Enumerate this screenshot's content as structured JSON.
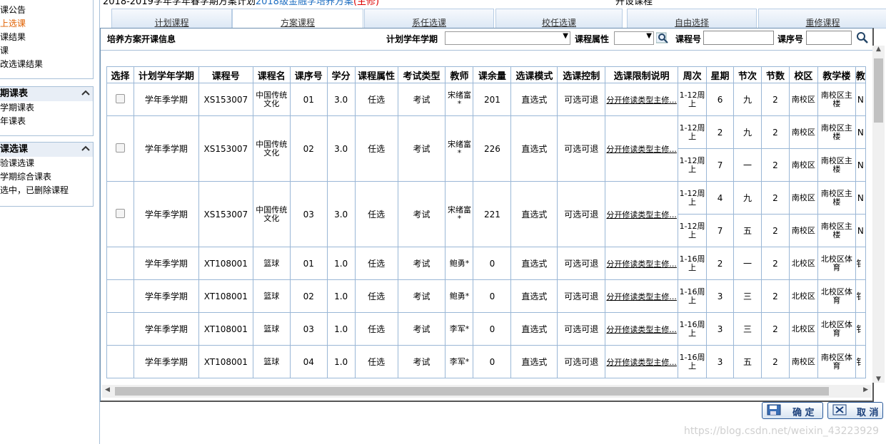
{
  "sidebar": {
    "top_items": [
      "课公告",
      "上选课",
      "课结果",
      "课",
      "改选课结果"
    ],
    "section1": {
      "title": "期课表",
      "items": [
        "学期课表",
        "年课表"
      ]
    },
    "section2": {
      "title": "课选课",
      "items": [
        "验课选课",
        "学期综合课表",
        "选中，已删除课程"
      ]
    }
  },
  "header": {
    "title_prefix": "2018-2019学年学年春学期方案计划",
    "title_blue": "2018级金融学培养方案",
    "title_red": "(主修)",
    "right_text": "开设课程"
  },
  "tabs": [
    "计划课程",
    "方案课程",
    "系任选课",
    "校任选课",
    "自由选择",
    "重修课程"
  ],
  "filter": {
    "title": "培养方案开课信息",
    "term_label": "计划学年学期",
    "attr_label": "课程属性",
    "course_no_label": "课程号",
    "seq_no_label": "课序号"
  },
  "columns": [
    "选择",
    "计划学年学期",
    "课程号",
    "课程名",
    "课序号",
    "学分",
    "课程属性",
    "考试类型",
    "教师",
    "课余量",
    "选课模式",
    "选课控制",
    "选课限制说明",
    "周次",
    "星期",
    "节次",
    "节数",
    "校区",
    "教学楼",
    "教"
  ],
  "rows": [
    {
      "check": true,
      "term": "学年季学期",
      "cno": "XS153007",
      "cname": "中国传统文化",
      "seq": "01",
      "credit": "3.0",
      "attr": "任选",
      "exam": "考试",
      "teacher": "宋绪富*",
      "remain": "201",
      "mode": "直选式",
      "ctrl": "可选可退",
      "limit": "分开修读类型主修...",
      "sessions": [
        {
          "weeks": "1-12周上",
          "day": "6",
          "period": "九",
          "count": "2",
          "campus": "南校区",
          "bldg": "南校区主楼",
          "extra": "N"
        }
      ]
    },
    {
      "check": true,
      "term": "学年季学期",
      "cno": "XS153007",
      "cname": "中国传统文化",
      "seq": "02",
      "credit": "3.0",
      "attr": "任选",
      "exam": "考试",
      "teacher": "宋绪富*",
      "remain": "226",
      "mode": "直选式",
      "ctrl": "可选可退",
      "limit": "分开修读类型主修...",
      "sessions": [
        {
          "weeks": "1-12周上",
          "day": "2",
          "period": "九",
          "count": "2",
          "campus": "南校区",
          "bldg": "南校区主楼",
          "extra": "N"
        },
        {
          "weeks": "1-12周上",
          "day": "7",
          "period": "一",
          "count": "2",
          "campus": "南校区",
          "bldg": "南校区主楼",
          "extra": "N"
        }
      ]
    },
    {
      "check": true,
      "term": "学年季学期",
      "cno": "XS153007",
      "cname": "中国传统文化",
      "seq": "03",
      "credit": "3.0",
      "attr": "任选",
      "exam": "考试",
      "teacher": "宋绪富*",
      "remain": "221",
      "mode": "直选式",
      "ctrl": "可选可退",
      "limit": "分开修读类型主修...",
      "sessions": [
        {
          "weeks": "1-12周上",
          "day": "4",
          "period": "九",
          "count": "2",
          "campus": "南校区",
          "bldg": "南校区主楼",
          "extra": "N"
        },
        {
          "weeks": "1-12周上",
          "day": "7",
          "period": "五",
          "count": "2",
          "campus": "南校区",
          "bldg": "南校区主楼",
          "extra": "N"
        }
      ]
    },
    {
      "check": false,
      "term": "学年季学期",
      "cno": "XT108001",
      "cname": "篮球",
      "seq": "01",
      "credit": "1.0",
      "attr": "任选",
      "exam": "考试",
      "teacher": "鲍勇*",
      "remain": "0",
      "mode": "直选式",
      "ctrl": "可选可退",
      "limit": "分开修读类型主修...",
      "sessions": [
        {
          "weeks": "1-16周上",
          "day": "2",
          "period": "一",
          "count": "2",
          "campus": "北校区",
          "bldg": "北校区体育",
          "extra": "钅"
        }
      ]
    },
    {
      "check": false,
      "term": "学年季学期",
      "cno": "XT108001",
      "cname": "篮球",
      "seq": "02",
      "credit": "1.0",
      "attr": "任选",
      "exam": "考试",
      "teacher": "鲍勇*",
      "remain": "0",
      "mode": "直选式",
      "ctrl": "可选可退",
      "limit": "分开修读类型主修...",
      "sessions": [
        {
          "weeks": "1-16周上",
          "day": "3",
          "period": "三",
          "count": "2",
          "campus": "北校区",
          "bldg": "北校区体育",
          "extra": "钅"
        }
      ]
    },
    {
      "check": false,
      "term": "学年季学期",
      "cno": "XT108001",
      "cname": "篮球",
      "seq": "03",
      "credit": "1.0",
      "attr": "任选",
      "exam": "考试",
      "teacher": "李军*",
      "remain": "0",
      "mode": "直选式",
      "ctrl": "可选可退",
      "limit": "分开修读类型主修...",
      "sessions": [
        {
          "weeks": "1-16周上",
          "day": "3",
          "period": "三",
          "count": "2",
          "campus": "北校区",
          "bldg": "北校区体育",
          "extra": "钅"
        }
      ]
    },
    {
      "check": false,
      "term": "学年季学期",
      "cno": "XT108001",
      "cname": "篮球",
      "seq": "04",
      "credit": "1.0",
      "attr": "任选",
      "exam": "考试",
      "teacher": "李军*",
      "remain": "0",
      "mode": "直选式",
      "ctrl": "可选可退",
      "limit": "分开修读类型主修...",
      "sessions": [
        {
          "weeks": "1-16周上",
          "day": "3",
          "period": "五",
          "count": "2",
          "campus": "南校区",
          "bldg": "南校区体育",
          "extra": "钅"
        }
      ]
    }
  ],
  "buttons": {
    "ok": "确 定",
    "cancel": "取 消"
  },
  "watermark": "https://blog.csdn.net/weixin_43223929",
  "colors": {
    "accent": "#1f6fc2",
    "active_menu": "#e06000",
    "grid_border": "#9ab7d6"
  }
}
